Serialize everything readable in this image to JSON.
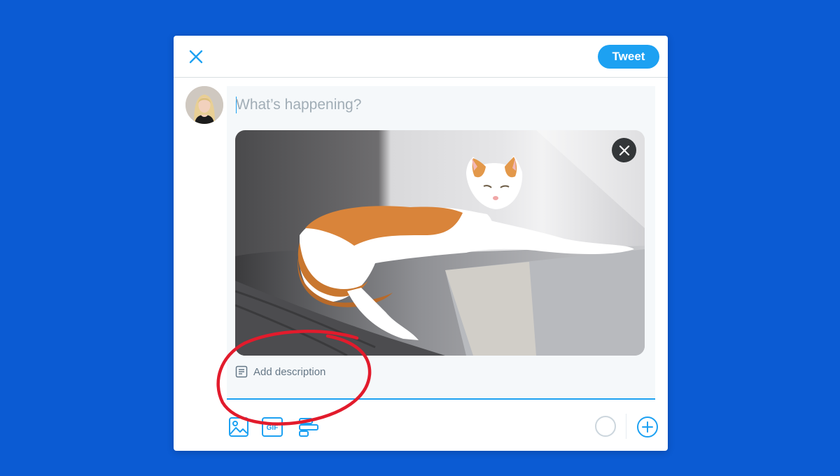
{
  "header": {
    "close_icon": "close-icon",
    "tweet_label": "Tweet"
  },
  "compose": {
    "placeholder": "What’s happening?",
    "avatar": "user-avatar",
    "media": {
      "description": "photo-attachment",
      "remove_icon": "close-icon"
    },
    "add_description_label": "Add description"
  },
  "toolbar": {
    "icons": [
      "image-icon",
      "gif-icon",
      "poll-icon"
    ],
    "add_icon": "plus-circle-icon"
  },
  "colors": {
    "background": "#0b5bd3",
    "accent": "#1da1f2",
    "annotation": "#e21b2c"
  }
}
